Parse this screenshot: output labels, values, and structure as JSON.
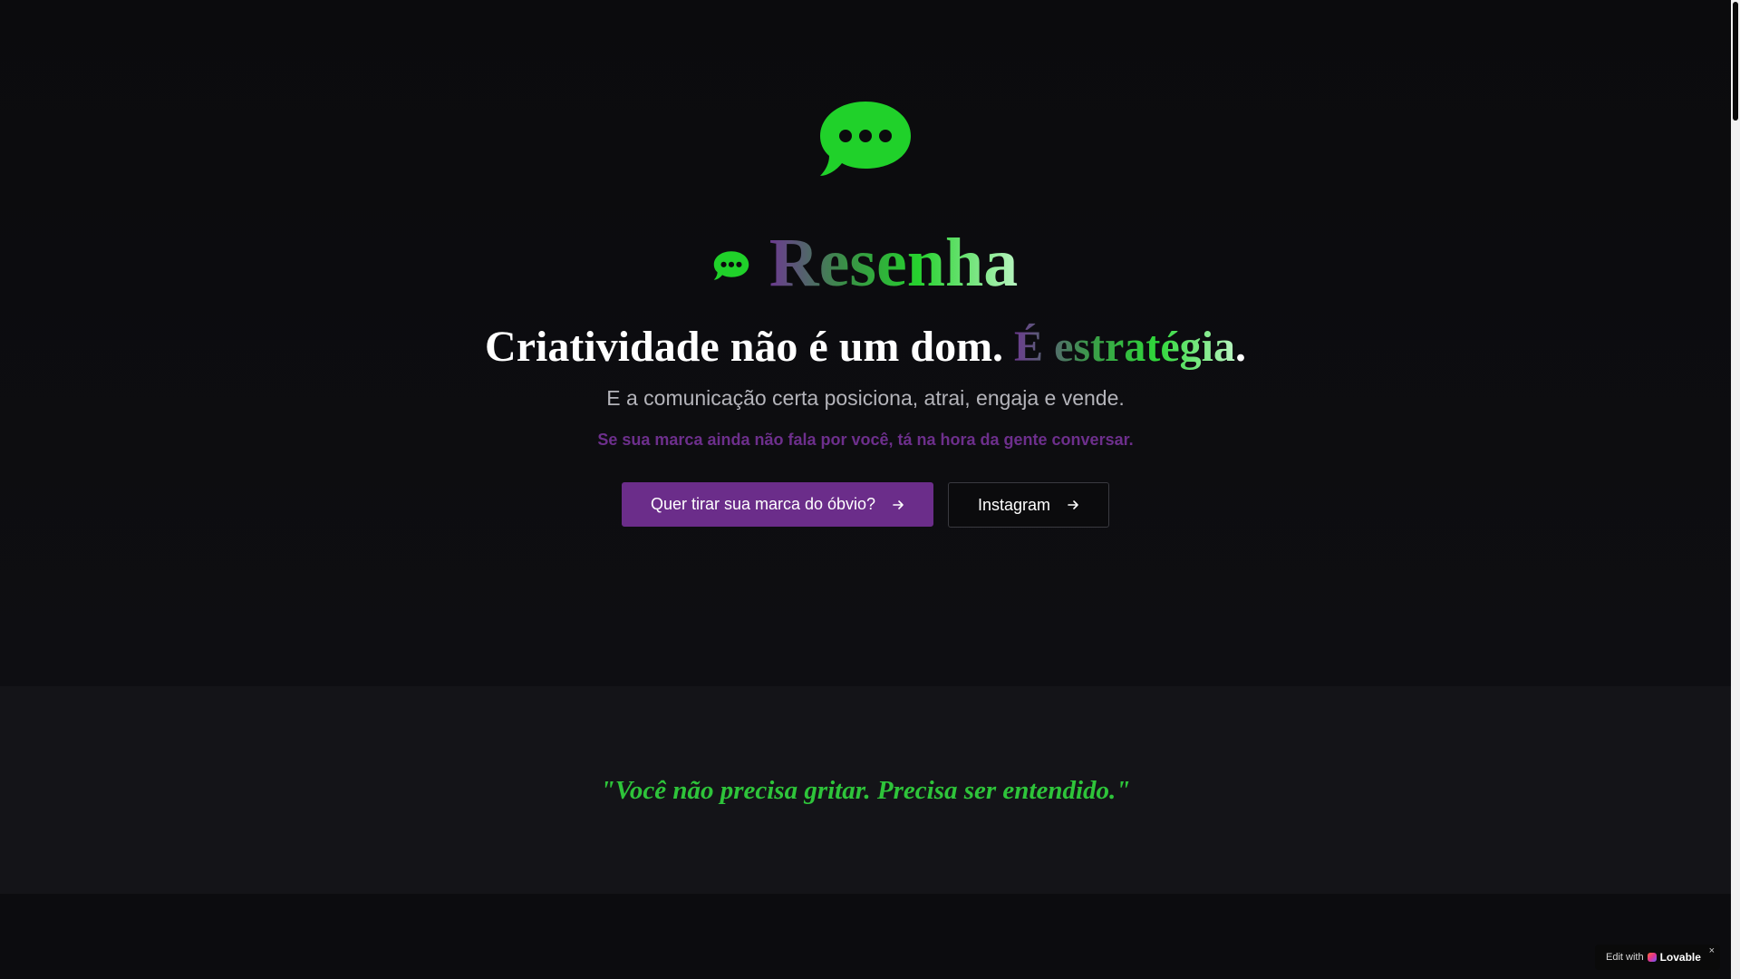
{
  "brand": {
    "name": "Resenha",
    "icon": "chat-bubble-icon",
    "accent_color": "#26d12e",
    "secondary_color": "#6b2d8a"
  },
  "hero": {
    "headline_main": "Criatividade não é um dom. ",
    "headline_accent": "É estratégia",
    "headline_period": ".",
    "subtitle": "E a comunicação certa posiciona, atrai, engaja e vende.",
    "tagline": "Se sua marca ainda não fala por você, tá na hora da gente conversar."
  },
  "buttons": {
    "primary_label": "Quer tirar sua marca do óbvio?",
    "secondary_label": "Instagram",
    "arrow_icon": "arrow-right-icon"
  },
  "quote": {
    "text": "\"Você não precisa gritar. Precisa ser entendido.\""
  },
  "badge": {
    "prefix": "Edit with",
    "brand": "Lovable",
    "close": "×"
  }
}
